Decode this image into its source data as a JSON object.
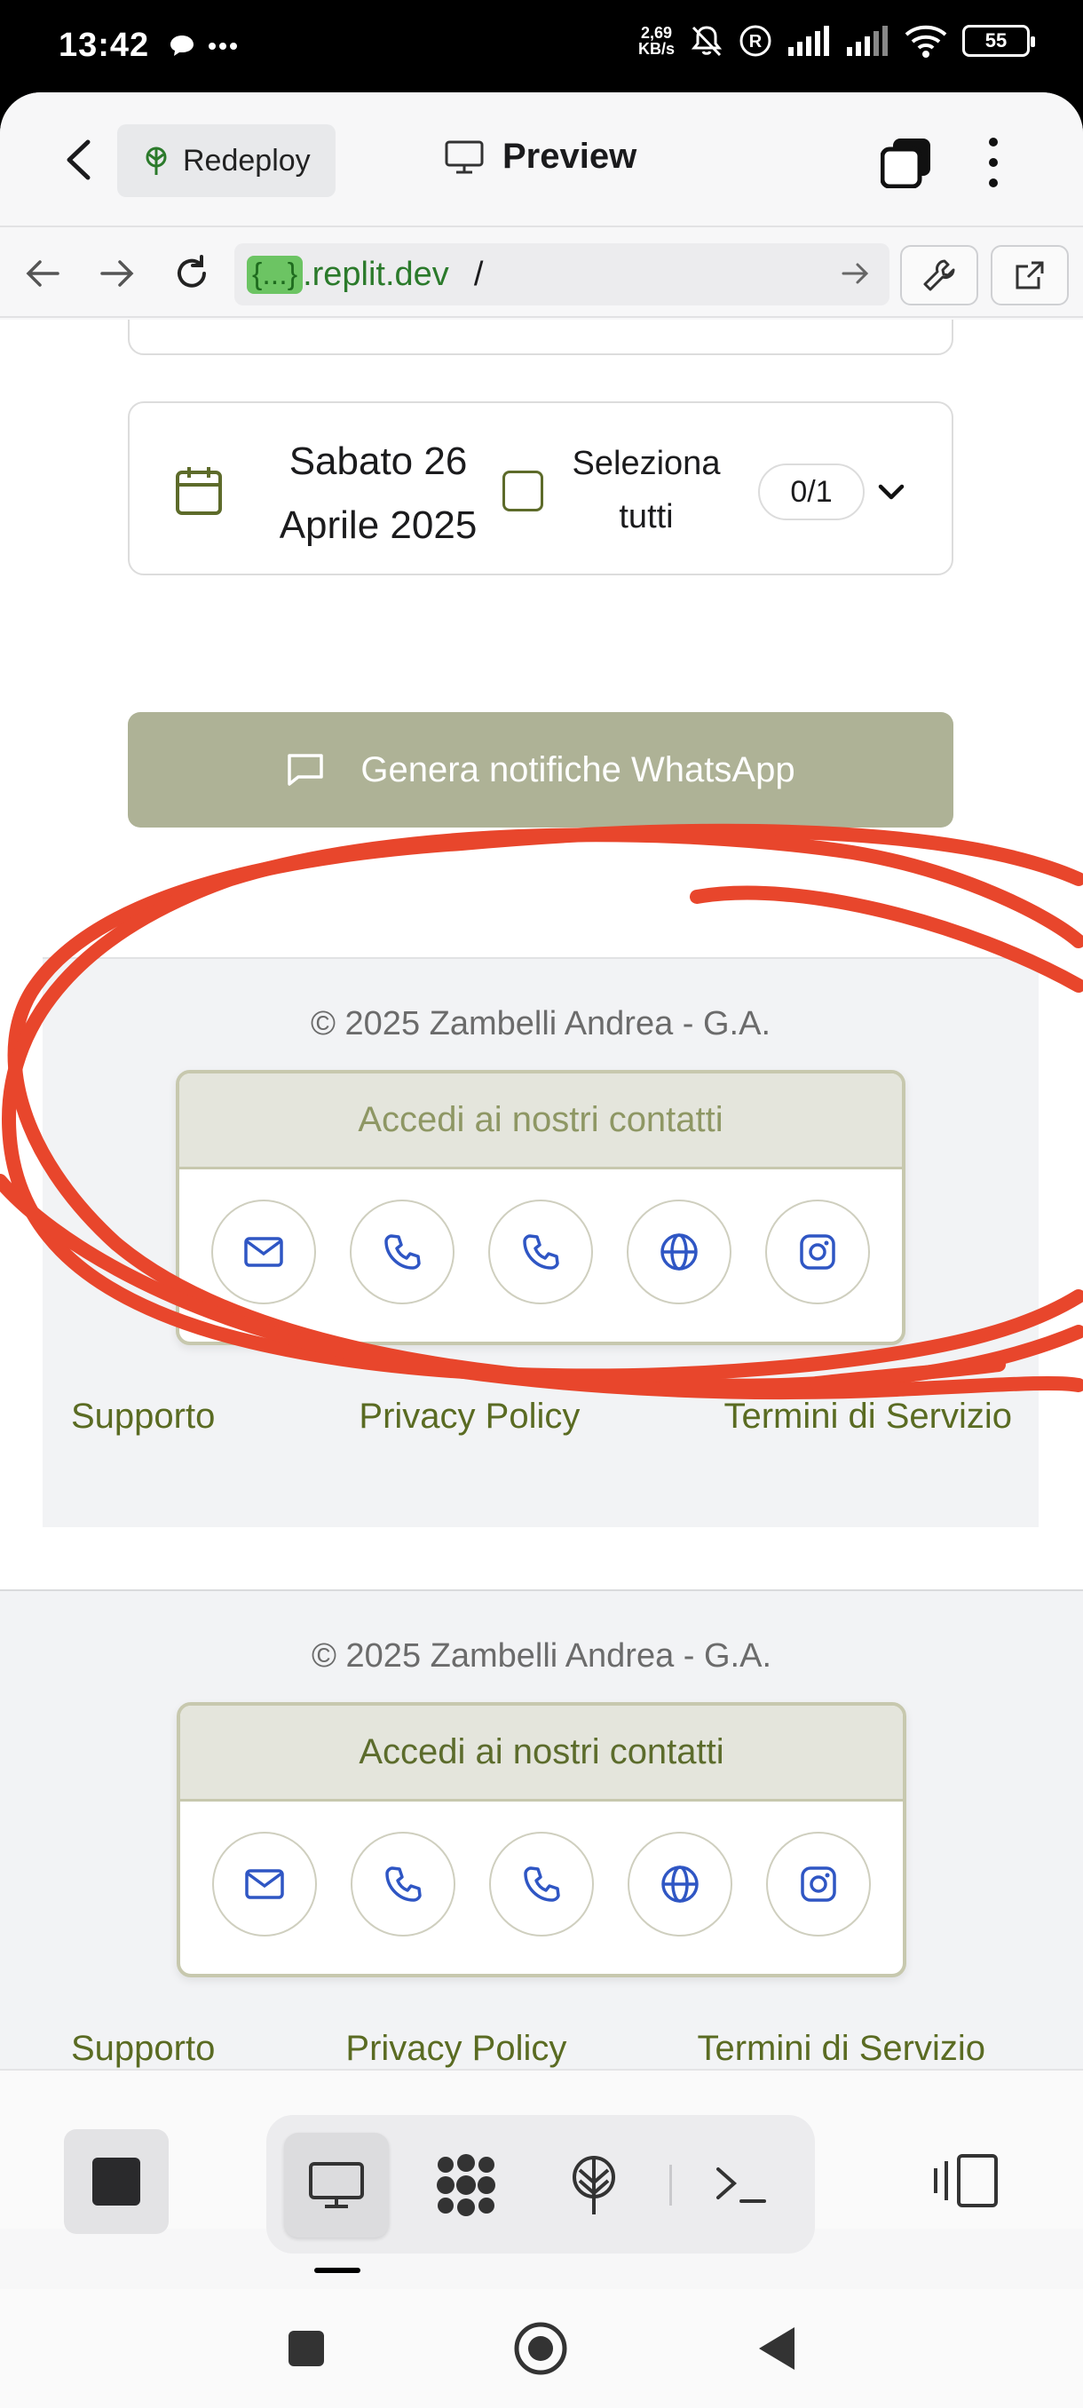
{
  "status_bar": {
    "time": "13:42",
    "net_speed_value": "2,69",
    "net_speed_unit": "KB/s",
    "battery": "55"
  },
  "app_bar": {
    "redeploy_label": "Redeploy",
    "title": "Preview"
  },
  "url_bar": {
    "chip": "{...}",
    "domain": ".replit.dev",
    "path": "/"
  },
  "page": {
    "date_card": {
      "date_line1": "Sabato 26",
      "date_line2": "Aprile 2025",
      "select_all_line1": "Seleziona",
      "select_all_line2": "tutti",
      "count": "0/1"
    },
    "whatsapp_button": "Genera notifiche WhatsApp",
    "footer_preview": {
      "copyright": "© 2025 Zambelli Andrea - G.A.",
      "contacts_title": "Accedi ai nostri contatti",
      "links": [
        "Supporto",
        "Privacy Policy",
        "Termini di Servizio"
      ]
    },
    "footer": {
      "copyright": "© 2025 Zambelli Andrea - G.A.",
      "contacts_title": "Accedi ai nostri contatti",
      "links": [
        "Supporto",
        "Privacy Policy",
        "Termini di Servizio"
      ]
    },
    "contact_icons": [
      "mail-icon",
      "phone-icon",
      "phone-icon",
      "globe-icon",
      "instagram-icon"
    ]
  },
  "toolbar": {
    "tools": [
      "preview-icon",
      "workspace-icon",
      "deploy-icon",
      "shell-icon"
    ]
  },
  "colors": {
    "accent_green": "#5a6b22",
    "whatsapp_button_bg": "#aeb296",
    "contact_icon_blue": "#2f56c4",
    "annotation_red": "#e8462c"
  }
}
